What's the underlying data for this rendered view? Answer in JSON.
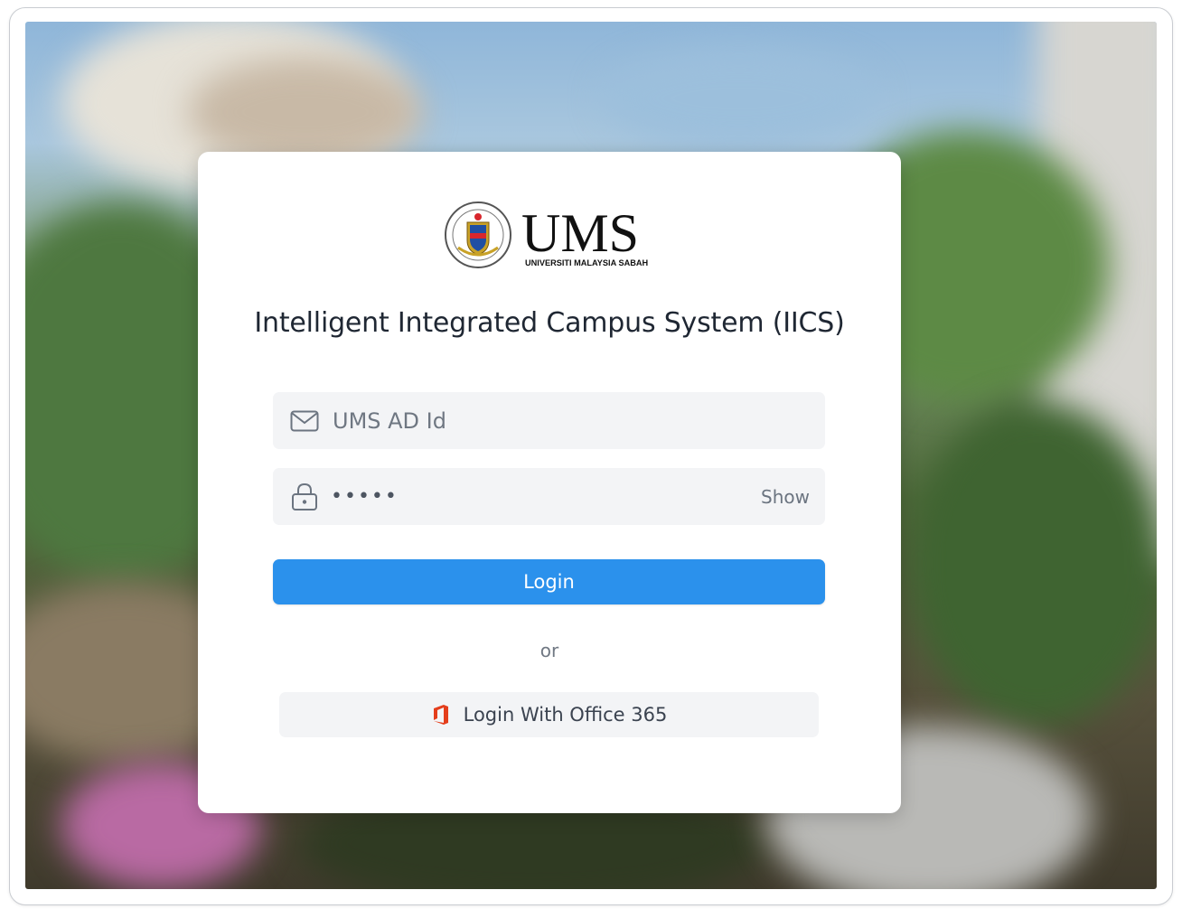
{
  "logo": {
    "wordmark": "UMS",
    "subtitle": "UNIVERSITI MALAYSIA SABAH"
  },
  "page_title": "Intelligent Integrated Campus System (IICS)",
  "form": {
    "username": {
      "placeholder": "UMS AD Id",
      "value": "",
      "icon": "envelope-icon"
    },
    "password": {
      "masked_value": "•••••",
      "icon": "lock-icon",
      "show_label": "Show"
    },
    "login_label": "Login",
    "separator": "or",
    "office365_label": "Login With Office 365",
    "office365_icon": "office-365-icon"
  },
  "colors": {
    "primary": "#2b91ec",
    "field_bg": "#f3f4f6",
    "title": "#1f2733",
    "office_red": "#e43e1c"
  }
}
